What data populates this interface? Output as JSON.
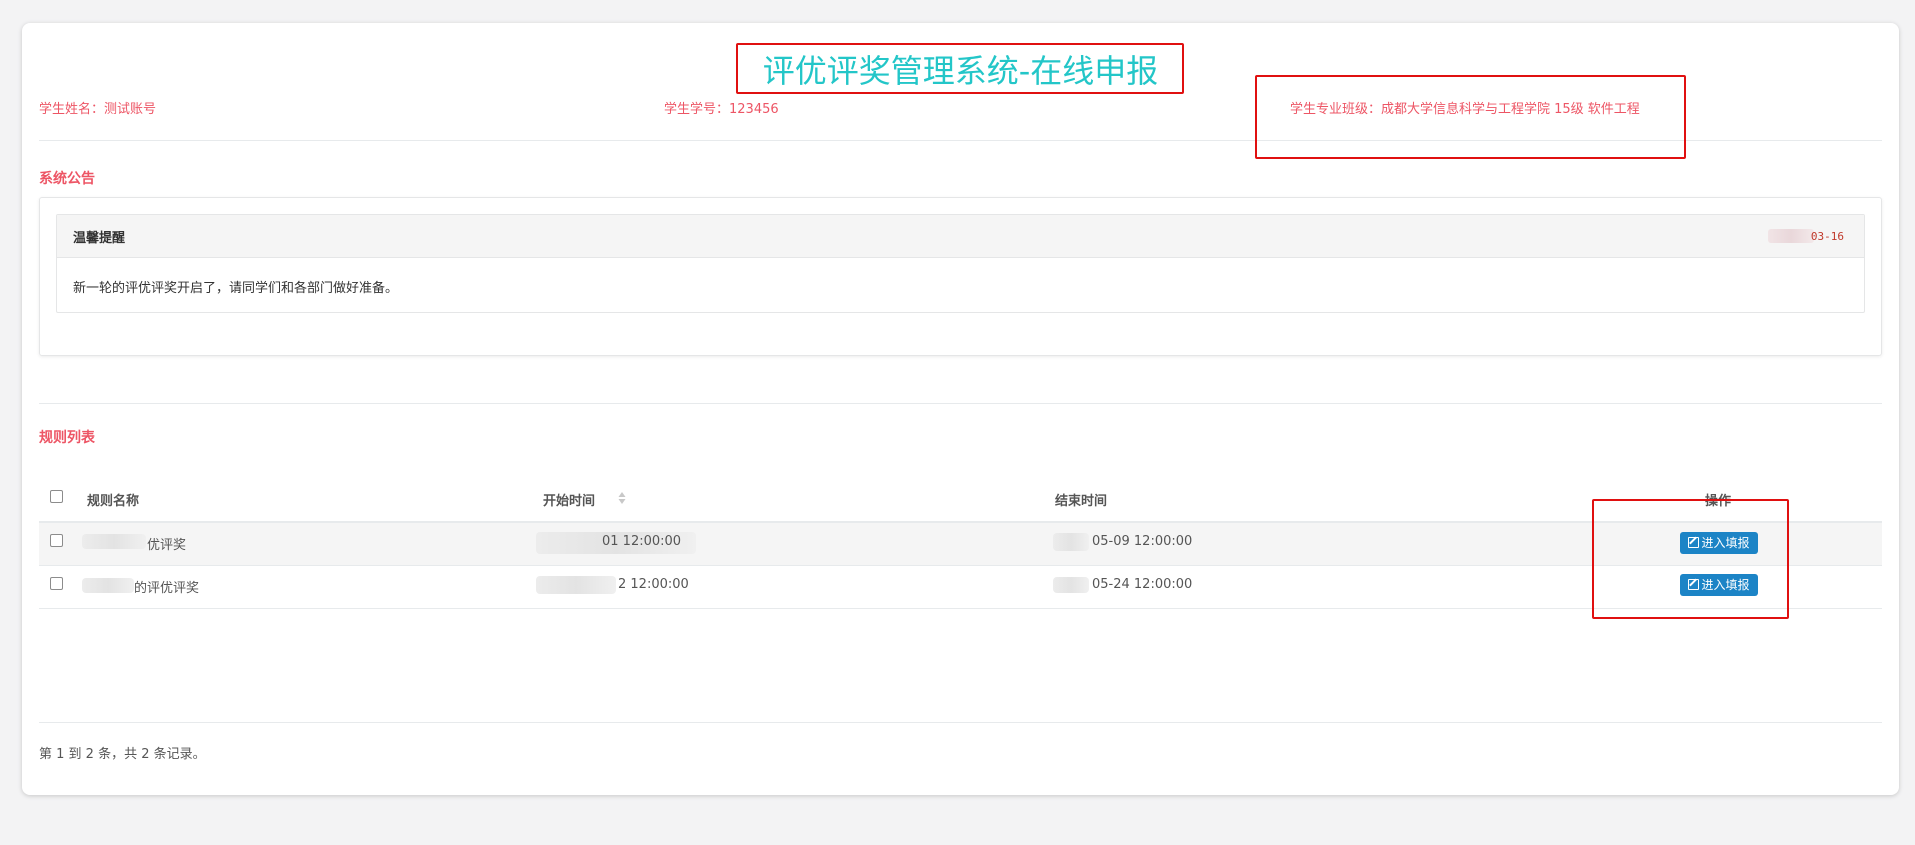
{
  "header": {
    "title": "评优评奖管理系统-在线申报",
    "student_name": "学生姓名：测试账号",
    "student_id": "学生学号：123456",
    "student_class": "学生专业班级：成都大学信息科学与工程学院 15级 软件工程"
  },
  "notice_section": {
    "title": "系统公告",
    "notice": {
      "title": "温馨提醒",
      "date_visible": "03-16",
      "body": "新一轮的评优评奖开启了，请同学们和各部门做好准备。"
    }
  },
  "rules_section": {
    "title": "规则列表",
    "columns": [
      "规则名称",
      "开始时间",
      "结束时间",
      "操作"
    ],
    "rows": [
      {
        "name_visible": "优评奖",
        "start_visible": "01 12:00:00",
        "end_visible": "05-09 12:00:00",
        "action_label": "进入填报"
      },
      {
        "name_visible": "的评优评奖",
        "start_visible": "2 12:00:00",
        "end_visible": "05-24 12:00:00",
        "action_label": "进入填报"
      }
    ]
  },
  "pagination": {
    "summary": "第 1 到 2 条，共 2 条记录。"
  },
  "colors": {
    "title": "#23c6c8",
    "info_text": "#ed5565",
    "button": "#1c84c6",
    "annotation_box": "#e01010"
  },
  "icons": {
    "sort": "sort-icon",
    "edit": "edit-icon"
  }
}
